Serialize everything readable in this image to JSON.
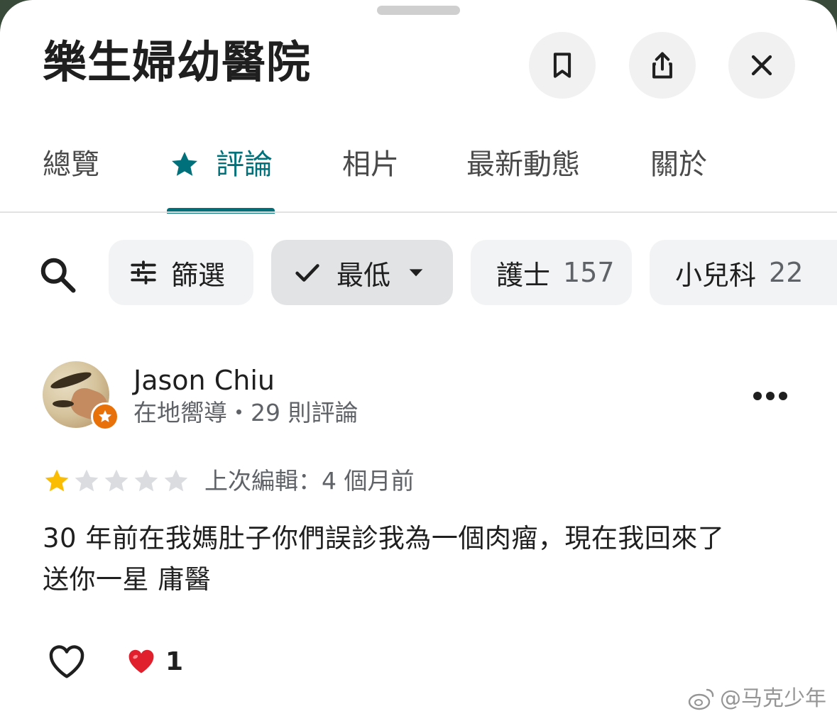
{
  "place": {
    "title": "樂生婦幼醫院"
  },
  "header_actions": {
    "save_icon": "bookmark-icon",
    "share_icon": "share-icon",
    "close_icon": "close-icon"
  },
  "tabs": [
    {
      "label": "總覽",
      "active": false
    },
    {
      "label": "評論",
      "active": true,
      "icon": "star-icon"
    },
    {
      "label": "相片",
      "active": false
    },
    {
      "label": "最新動態",
      "active": false
    },
    {
      "label": "關於",
      "active": false
    }
  ],
  "filters": {
    "search_icon": "search-icon",
    "filter_chip": {
      "label": "篩選",
      "icon": "tune-icon"
    },
    "sort_chip": {
      "label": "最低",
      "selected": true,
      "icon": "check-icon",
      "dropdown_icon": "caret-down-icon"
    },
    "topic_chips": [
      {
        "label": "護士",
        "count": "157"
      },
      {
        "label": "小兒科",
        "count": "22"
      }
    ]
  },
  "review": {
    "author": "Jason Chiu",
    "author_meta": "在地嚮導・29 則評論",
    "rating": 1,
    "rating_max": 5,
    "edited": "上次編輯：4 個月前",
    "text": "30 年前在我媽肚子你們誤診我為一個肉瘤，現在我回來了\n送你一星 庸醫",
    "reaction_count": "1"
  },
  "watermark": "@马克少年",
  "colors": {
    "accent": "#00707a",
    "star_filled": "#fbbc04",
    "star_empty": "#dadce0",
    "guide_badge": "#e8710a"
  }
}
